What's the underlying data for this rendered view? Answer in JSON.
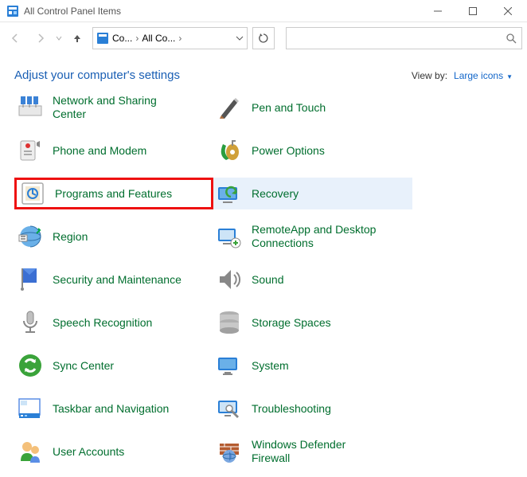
{
  "window": {
    "title": "All Control Panel Items"
  },
  "breadcrumbs": {
    "a": "Co...",
    "b": "All Co..."
  },
  "header": {
    "title": "Adjust your computer's settings",
    "viewby_label": "View by:",
    "viewby_value": "Large icons"
  },
  "items": {
    "left": [
      {
        "label": "Network and Sharing Center",
        "key": "network-sharing"
      },
      {
        "label": "Phone and Modem",
        "key": "phone-modem"
      },
      {
        "label": "Programs and Features",
        "key": "programs-features",
        "highlight": true
      },
      {
        "label": "Region",
        "key": "region"
      },
      {
        "label": "Security and Maintenance",
        "key": "security-maintenance"
      },
      {
        "label": "Speech Recognition",
        "key": "speech"
      },
      {
        "label": "Sync Center",
        "key": "sync"
      },
      {
        "label": "Taskbar and Navigation",
        "key": "taskbar"
      },
      {
        "label": "User Accounts",
        "key": "user-accounts"
      }
    ],
    "right": [
      {
        "label": "Pen and Touch",
        "key": "pen-touch"
      },
      {
        "label": "Power Options",
        "key": "power"
      },
      {
        "label": "Recovery",
        "key": "recovery",
        "hover": true
      },
      {
        "label": "RemoteApp and Desktop Connections",
        "key": "remoteapp"
      },
      {
        "label": "Sound",
        "key": "sound"
      },
      {
        "label": "Storage Spaces",
        "key": "storage"
      },
      {
        "label": "System",
        "key": "system"
      },
      {
        "label": "Troubleshooting",
        "key": "troubleshooting"
      },
      {
        "label": "Windows Defender Firewall",
        "key": "firewall"
      }
    ]
  }
}
